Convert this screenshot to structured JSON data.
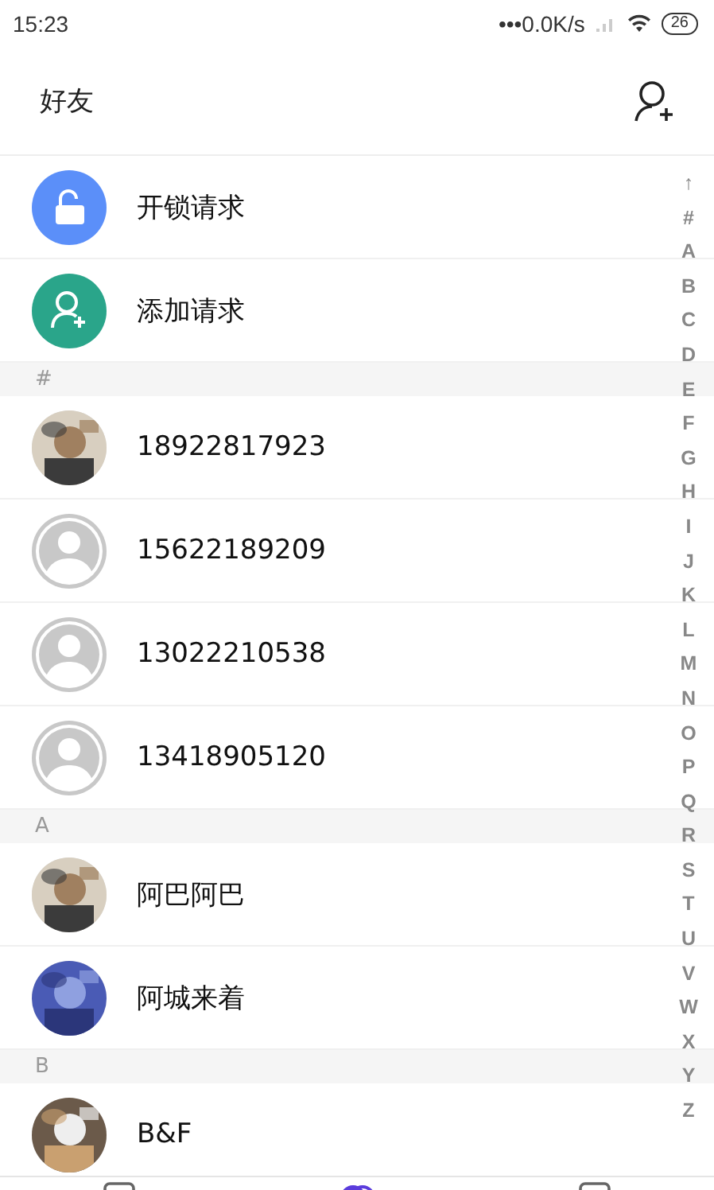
{
  "status_bar": {
    "time": "15:23",
    "speed": "•••0.0K/s",
    "battery": "26"
  },
  "header": {
    "title": "好友"
  },
  "requests": [
    {
      "kind": "unlock",
      "label": "开锁请求",
      "color": "#5b8ff9"
    },
    {
      "kind": "add",
      "label": "添加请求",
      "color": "#2aa58a"
    }
  ],
  "sections": [
    {
      "letter": "#",
      "contacts": [
        {
          "name": "18922817923"
        },
        {
          "name": "15622189209",
          "kind": "default"
        },
        {
          "name": "13022210538",
          "kind": "default"
        },
        {
          "name": "13418905120",
          "kind": "default"
        }
      ]
    },
    {
      "letter": "A",
      "contacts": [
        {
          "name": "阿巴阿巴"
        },
        {
          "name": "阿城来着"
        }
      ]
    },
    {
      "letter": "B",
      "contacts": [
        {
          "name": "B&F"
        }
      ]
    }
  ],
  "index": [
    "↑",
    "#",
    "A",
    "B",
    "C",
    "D",
    "E",
    "F",
    "G",
    "H",
    "I",
    "J",
    "K",
    "L",
    "M",
    "N",
    "O",
    "P",
    "Q",
    "R",
    "S",
    "T",
    "U",
    "V",
    "W",
    "X",
    "Y",
    "Z"
  ],
  "tabs": [
    {
      "selected": false
    },
    {
      "selected": true
    },
    {
      "selected": false
    }
  ]
}
